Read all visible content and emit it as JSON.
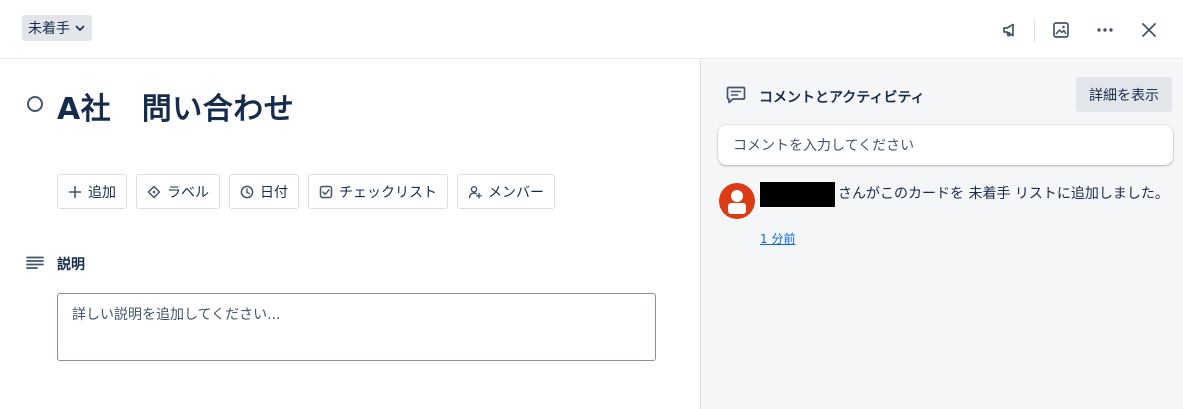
{
  "header": {
    "list_name": "未着手",
    "icons": [
      "megaphone-icon",
      "image-icon",
      "more-icon",
      "close-icon"
    ]
  },
  "card": {
    "title": "A社　問い合わせ",
    "actions": [
      {
        "label": "追加",
        "icon": "plus-icon"
      },
      {
        "label": "ラベル",
        "icon": "tag-icon"
      },
      {
        "label": "日付",
        "icon": "clock-icon"
      },
      {
        "label": "チェックリスト",
        "icon": "checkbox-icon"
      },
      {
        "label": "メンバー",
        "icon": "add-person-icon"
      }
    ],
    "description": {
      "title": "説明",
      "placeholder": "詳しい説明を追加してください..."
    }
  },
  "activity": {
    "heading": "コメントとアクティビティ",
    "details_button": "詳細を表示",
    "comment_placeholder": "コメントを入力してください",
    "items": [
      {
        "text": "さんがこのカードを 未着手 リストに追加しました。",
        "time": "1 分前"
      }
    ]
  },
  "colors": {
    "avatar": "#dd3b16",
    "link": "#0c66e4",
    "sidebar_bg": "#f5f6f8"
  }
}
